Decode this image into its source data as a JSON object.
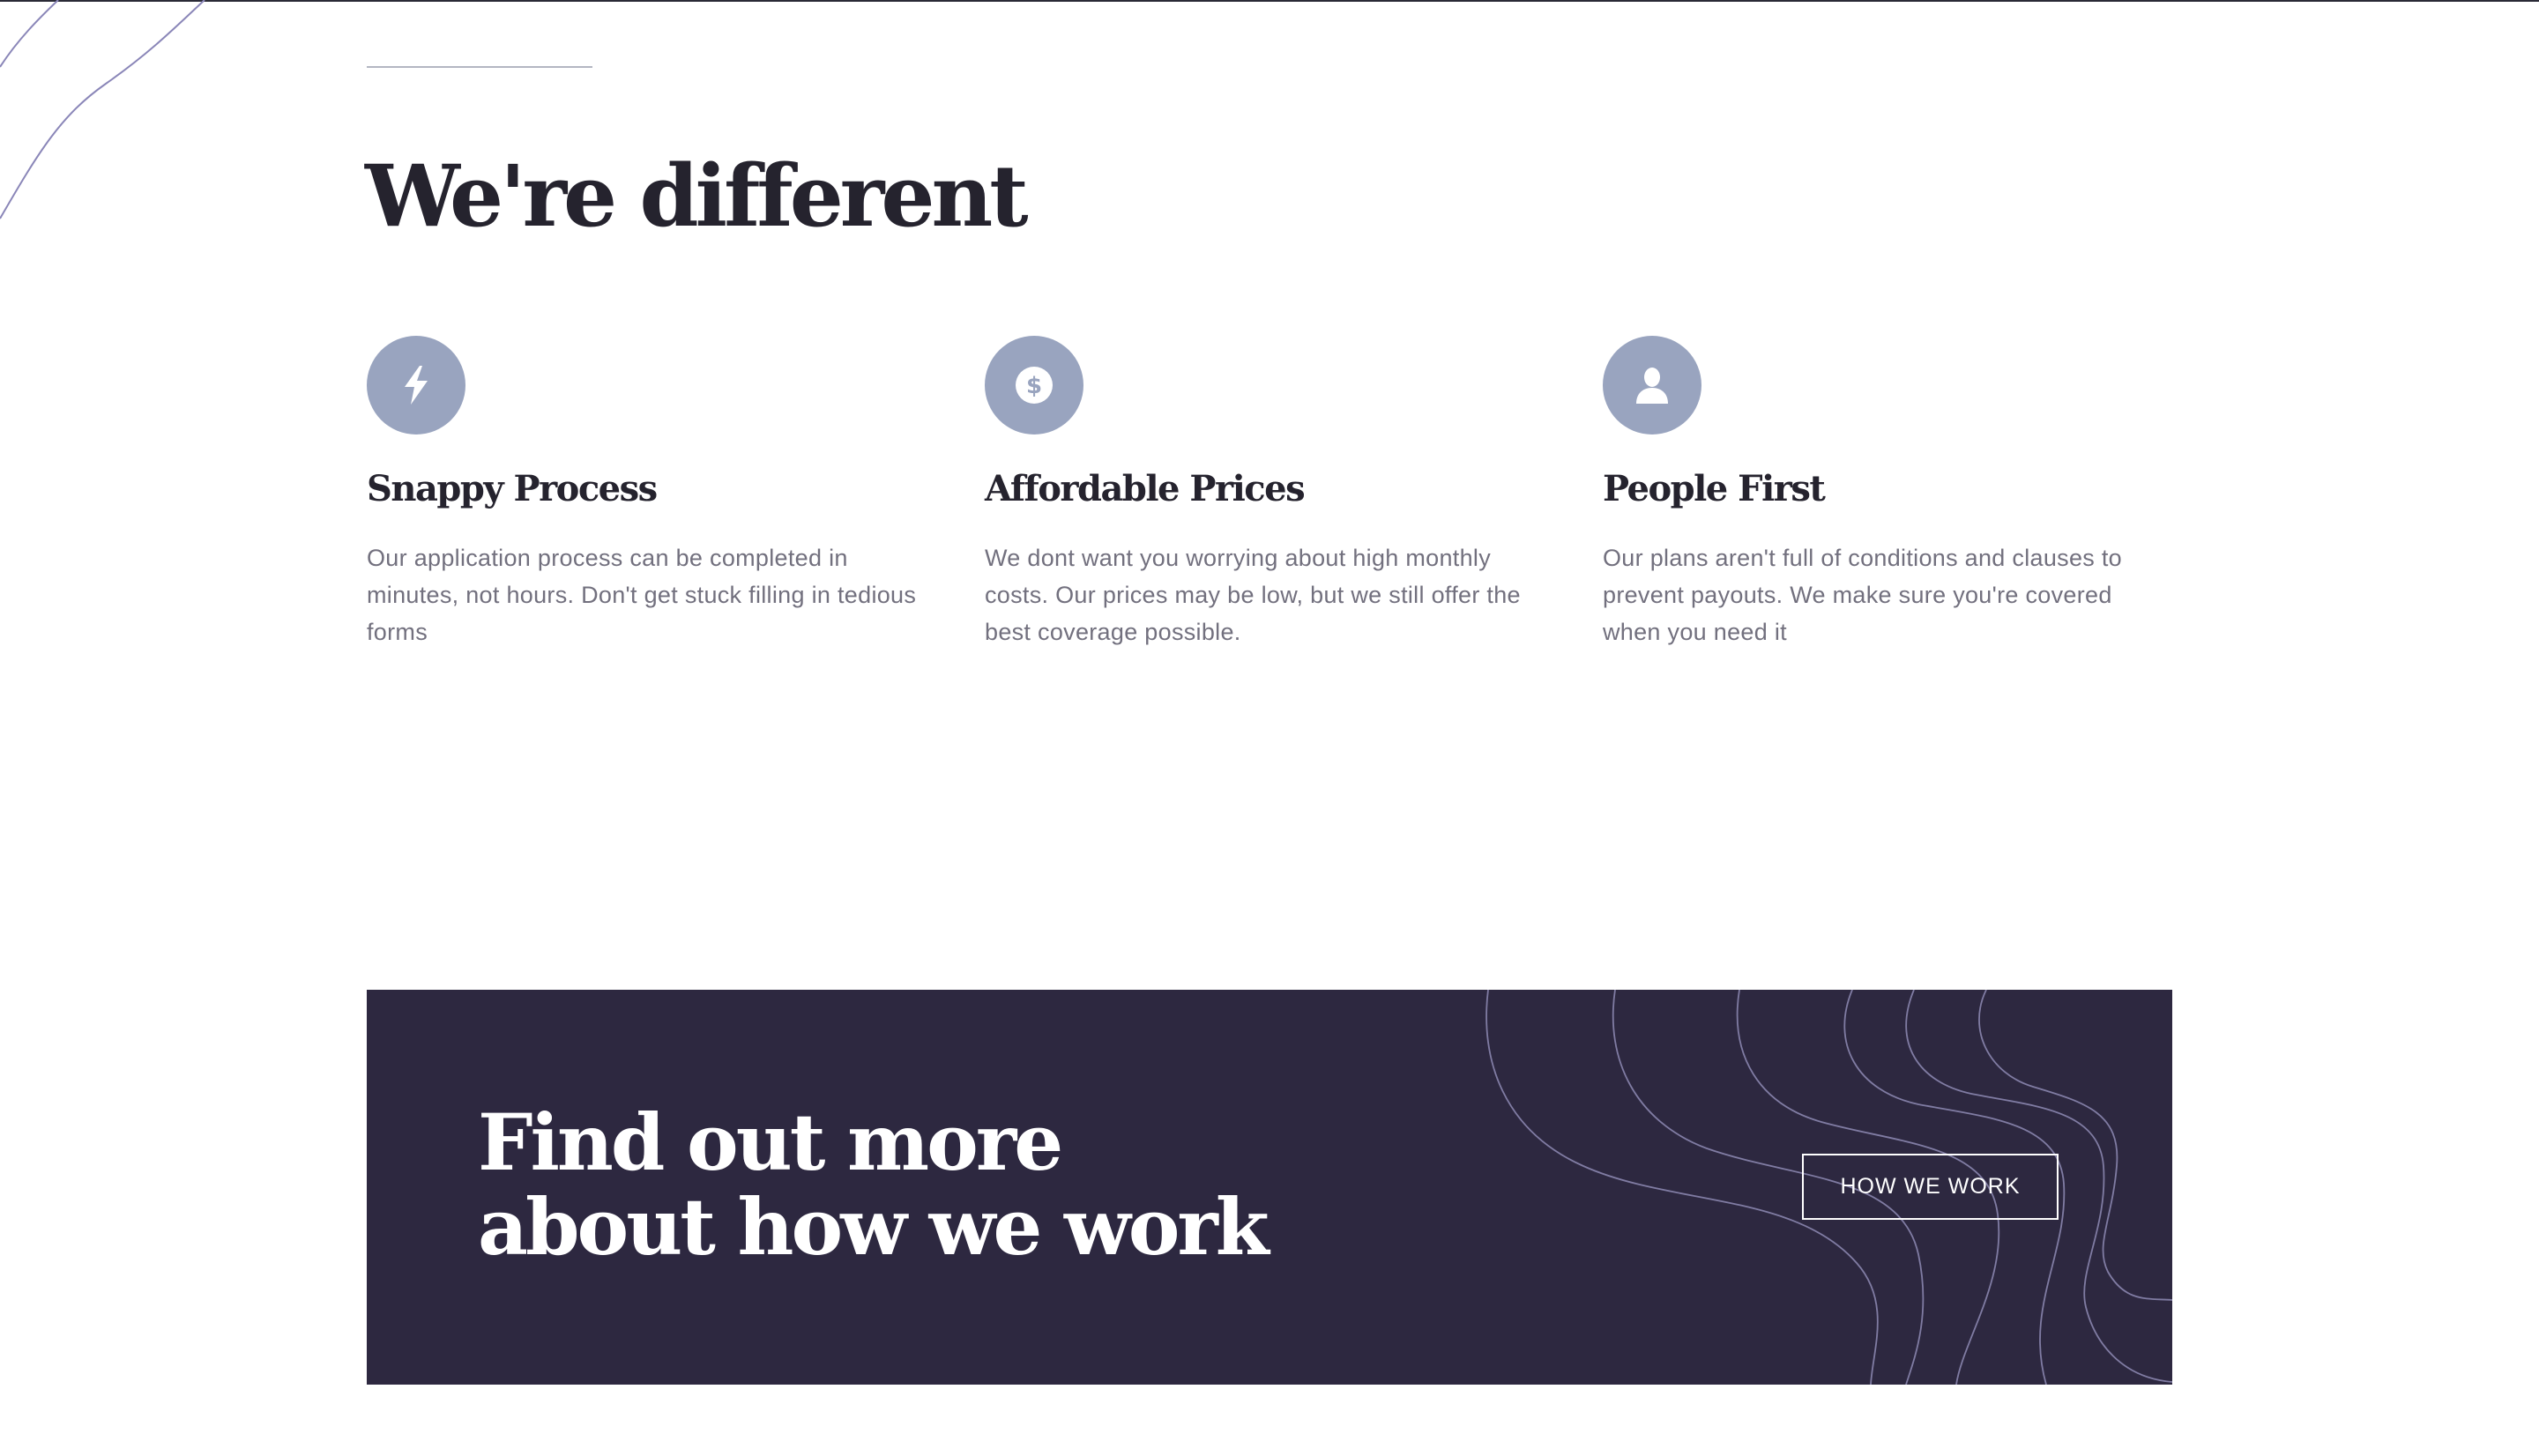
{
  "section": {
    "title": "We're different"
  },
  "features": [
    {
      "icon": "lightning-icon",
      "title": "Snappy Process",
      "text": "Our application process can be completed in minutes, not hours. Don't get stuck filling in tedious forms"
    },
    {
      "icon": "dollar-coin-icon",
      "title": "Affordable Prices",
      "text": "We dont want you worrying about high monthly costs. Our prices may be low, but we still offer the best coverage possible."
    },
    {
      "icon": "person-icon",
      "title": "People First",
      "text": "Our plans aren't full of conditions and clauses to prevent payouts. We make sure you're covered when you need it"
    }
  ],
  "cta": {
    "title_line1": "Find out more",
    "title_line2": "about how we work",
    "button_label": "HOW WE WORK"
  },
  "colors": {
    "heading": "#25232e",
    "body_text": "#72707e",
    "icon_circle": "#99a4bf",
    "banner_bg": "#2d2840",
    "curve_stroke": "#6f6a9c"
  }
}
